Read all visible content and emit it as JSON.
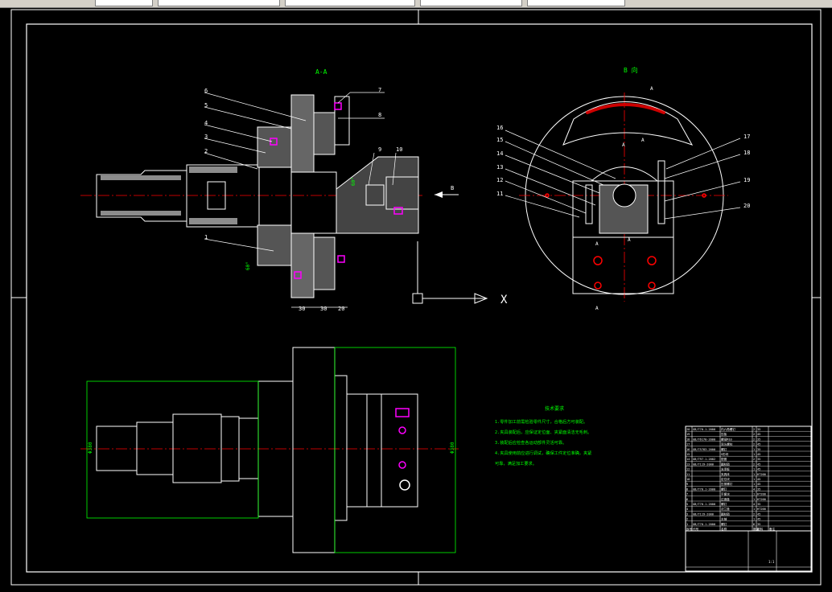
{
  "toolbar": {
    "controls": [
      "toolbar-control-1",
      "toolbar-control-2",
      "toolbar-control-3",
      "toolbar-control-4",
      "toolbar-control-5"
    ]
  },
  "views": {
    "section_aa": "A-A",
    "view_b": "B 向",
    "arrow_b": "B",
    "section_mark": "A",
    "axis_x": "X"
  },
  "part_numbers_left": [
    "1",
    "2",
    "3",
    "4",
    "5",
    "6",
    "7",
    "8",
    "9",
    "10"
  ],
  "part_numbers_right": [
    "11",
    "12",
    "13",
    "14",
    "15",
    "16",
    "17",
    "18",
    "19",
    "20"
  ],
  "dimensions": {
    "bottom": [
      "30",
      "30",
      "20"
    ],
    "angle_top": "60°",
    "angle_bottom": "60°",
    "height_left": "Φ380",
    "height_right": "Φ380"
  },
  "notes": {
    "title": "技术要求",
    "lines": [
      "1.零件加工前需检验零件尺寸，合格后方可装配。",
      "2.夹具装配后，应保证定位面、夹紧面清洁无毛刺。",
      "3.装配后应检查各运动部件灵活可靠。",
      "4.夹具使用前应进行调试，确保工件定位准确，夹紧",
      "可靠，满足加工要求。"
    ]
  },
  "title_block": {
    "rows": [
      [
        "20",
        "GB/T70.1-2000",
        "内六角螺钉",
        "2",
        "35",
        ""
      ],
      [
        "19",
        "",
        "压板",
        "2",
        "45",
        ""
      ],
      [
        "18",
        "GB/T6170-2000",
        "螺母M10",
        "2",
        "35",
        ""
      ],
      [
        "17",
        "",
        "双头螺柱",
        "2",
        "45",
        ""
      ],
      [
        "16",
        "GB/T5783-2000",
        "螺钉",
        "1",
        "35",
        ""
      ],
      [
        "15",
        "",
        "V形块",
        "1",
        "45",
        ""
      ],
      [
        "14",
        "GB/T97.1-2002",
        "垫圈",
        "2",
        "35",
        ""
      ],
      [
        "13",
        "GB/T119-2000",
        "圆柱销",
        "2",
        "45",
        ""
      ],
      [
        "12",
        "",
        "支承板",
        "1",
        "45",
        ""
      ],
      [
        "11",
        "",
        "夹具体",
        "1",
        "HT200",
        ""
      ],
      [
        "10",
        "",
        "定位块",
        "1",
        "45",
        ""
      ],
      [
        "9",
        "",
        "压紧螺钉",
        "1",
        "45",
        ""
      ],
      [
        "8",
        "GB/T70.1-2000",
        "螺钉",
        "4",
        "35",
        ""
      ],
      [
        "7",
        "",
        "平衡块",
        "1",
        "HT200",
        ""
      ],
      [
        "6",
        "",
        "过渡盘",
        "1",
        "HT200",
        ""
      ],
      [
        "5",
        "GB/T70.1-2000",
        "螺钉",
        "4",
        "35",
        ""
      ],
      [
        "4",
        "",
        "法兰盘",
        "1",
        "HT200",
        ""
      ],
      [
        "3",
        "GB/T119-2000",
        "圆柱销",
        "2",
        "45",
        ""
      ],
      [
        "2",
        "",
        "主轴",
        "1",
        "45",
        ""
      ],
      [
        "1",
        "GB/T70.1-2000",
        "螺钉",
        "6",
        "35",
        ""
      ]
    ],
    "header": [
      "序号",
      "代号",
      "名称",
      "数量",
      "材料",
      "备注"
    ],
    "sheet_no": "1:1"
  }
}
